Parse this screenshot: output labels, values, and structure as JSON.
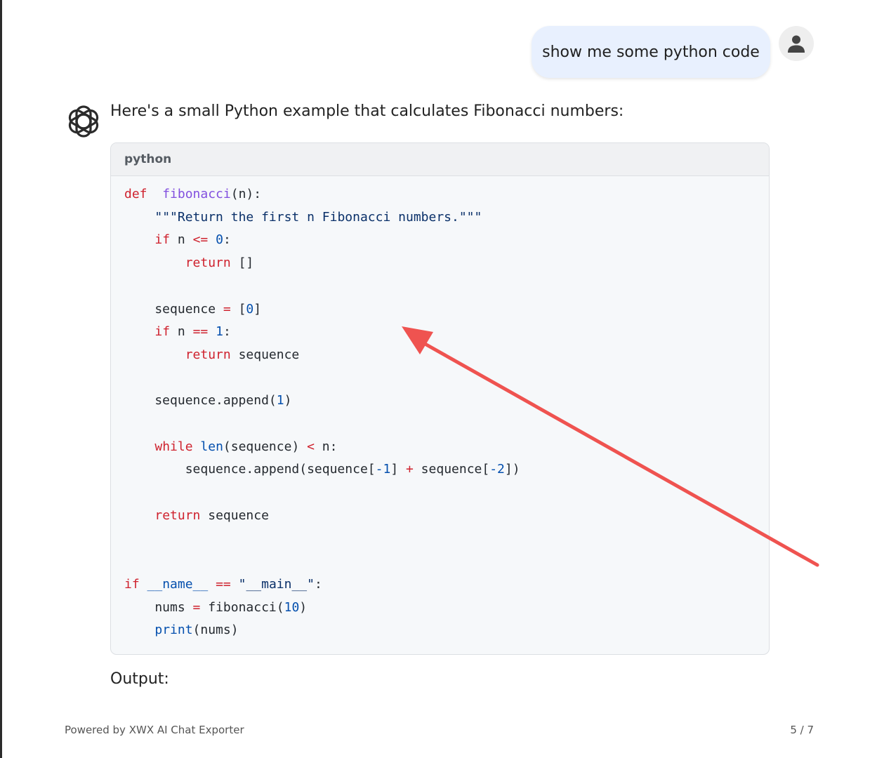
{
  "user_message": "show me some python code",
  "assistant": {
    "intro": "Here's a small Python example that calculates Fibonacci numbers:",
    "code_language": "python",
    "code_lines": [
      [
        [
          "kw",
          "def"
        ],
        [
          "",
          "  "
        ],
        [
          "fn",
          "fibonacci"
        ],
        [
          "",
          "(n):"
        ]
      ],
      [
        [
          "",
          "    "
        ],
        [
          "str",
          "\"\"\"Return the first n Fibonacci numbers.\"\"\""
        ]
      ],
      [
        [
          "",
          "    "
        ],
        [
          "kw",
          "if"
        ],
        [
          "",
          " n "
        ],
        [
          "op",
          "<="
        ],
        [
          "",
          " "
        ],
        [
          "num",
          "0"
        ],
        [
          "",
          ":"
        ]
      ],
      [
        [
          "",
          "        "
        ],
        [
          "kw",
          "return"
        ],
        [
          "",
          " []"
        ]
      ],
      [],
      [
        [
          "",
          "    sequence "
        ],
        [
          "op",
          "="
        ],
        [
          "",
          " ["
        ],
        [
          "num",
          "0"
        ],
        [
          "",
          "]"
        ]
      ],
      [
        [
          "",
          "    "
        ],
        [
          "kw",
          "if"
        ],
        [
          "",
          " n "
        ],
        [
          "op",
          "=="
        ],
        [
          "",
          " "
        ],
        [
          "num",
          "1"
        ],
        [
          "",
          ":"
        ]
      ],
      [
        [
          "",
          "        "
        ],
        [
          "kw",
          "return"
        ],
        [
          "",
          " sequence"
        ]
      ],
      [],
      [
        [
          "",
          "    sequence.append("
        ],
        [
          "num",
          "1"
        ],
        [
          "",
          ")"
        ]
      ],
      [],
      [
        [
          "",
          "    "
        ],
        [
          "kw",
          "while"
        ],
        [
          "",
          " "
        ],
        [
          "bi",
          "len"
        ],
        [
          "",
          "(sequence) "
        ],
        [
          "op",
          "<"
        ],
        [
          "",
          " n:"
        ]
      ],
      [
        [
          "",
          "        sequence.append(sequence["
        ],
        [
          "num",
          "-1"
        ],
        [
          "",
          "] "
        ],
        [
          "op",
          "+"
        ],
        [
          "",
          " sequence["
        ],
        [
          "num",
          "-2"
        ],
        [
          "",
          "])"
        ]
      ],
      [],
      [
        [
          "",
          "    "
        ],
        [
          "kw",
          "return"
        ],
        [
          "",
          " sequence"
        ]
      ],
      [],
      [],
      [
        [
          "kw",
          "if"
        ],
        [
          "",
          " "
        ],
        [
          "bi",
          "__name__"
        ],
        [
          "",
          " "
        ],
        [
          "op",
          "=="
        ],
        [
          "",
          " "
        ],
        [
          "str",
          "\"__main__\""
        ],
        [
          "",
          ":"
        ]
      ],
      [
        [
          "",
          "    nums "
        ],
        [
          "op",
          "="
        ],
        [
          "",
          " fibonacci("
        ],
        [
          "num",
          "10"
        ],
        [
          "",
          ")"
        ]
      ],
      [
        [
          "",
          "    "
        ],
        [
          "bi",
          "print"
        ],
        [
          "",
          "(nums)"
        ]
      ]
    ],
    "output_label": "Output:"
  },
  "footer": {
    "powered_by": "Powered by XWX AI Chat Exporter",
    "page_indicator": "5 / 7"
  },
  "colors": {
    "user_bubble": "#e8f0fe",
    "code_background": "#f6f8fa",
    "annotation_arrow": "#ef5350",
    "keyword": "#cf222e",
    "function_name": "#8250df",
    "string": "#0a3069",
    "number": "#0550ae"
  },
  "icons": {
    "user_avatar": "person-icon",
    "assistant_logo": "openai-logo-icon",
    "annotation": "red-arrow-annotation"
  }
}
